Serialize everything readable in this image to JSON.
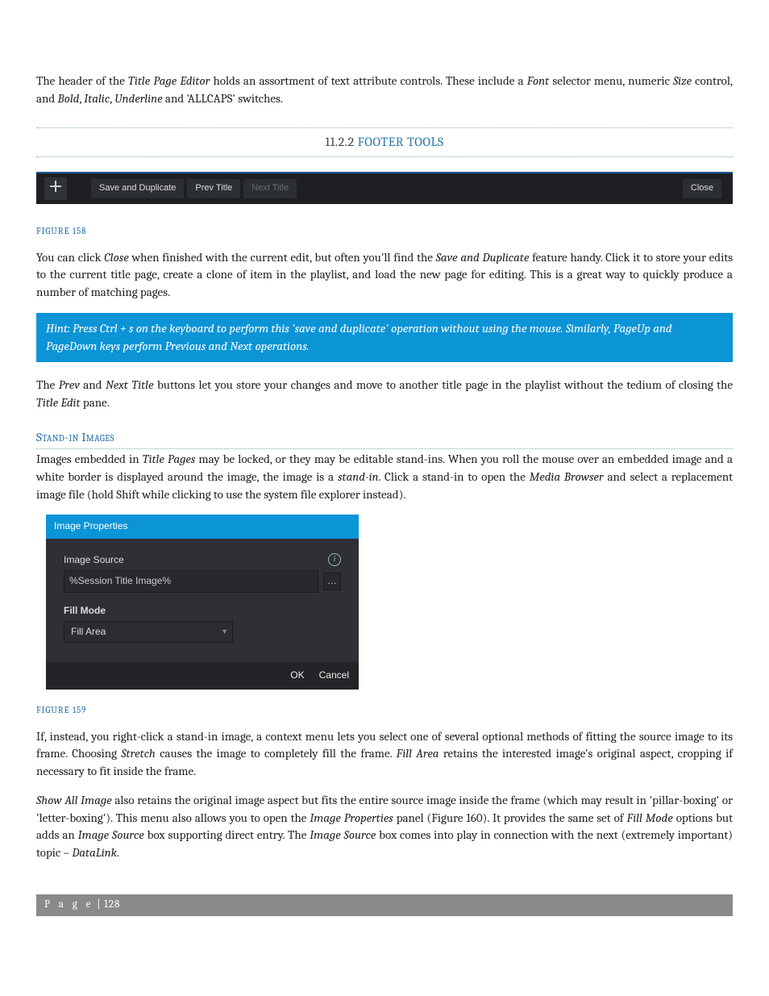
{
  "para1": {
    "a": "The header of the ",
    "b": "Title Page Editor",
    "c": " holds an assortment of text attribute controls.  These include a ",
    "d": "Font",
    "e": " selector menu, numeric ",
    "f": "Size",
    "g": " control, and ",
    "h": "Bold",
    "i": ", ",
    "j": "Italic",
    "k": ", ",
    "l": "Underline",
    "m": " and 'ALLCAPS' switches."
  },
  "section": {
    "num": "11.2.2",
    "title": "FOOTER TOOLS"
  },
  "toolbar": {
    "saveDup": "Save and Duplicate",
    "prev": "Prev Title",
    "next": "Next Title",
    "close": "Close"
  },
  "fig158": "FIGURE 158",
  "para2": {
    "a": "You can click ",
    "b": "Close",
    "c": " when finished with the current edit, but often you'll find the ",
    "d": "Save and Duplicate",
    "e": " feature handy.  Click it to store your edits to the current title page, create a clone of item in the playlist, and load the new page for editing.  This is a great way to quickly produce a number of matching pages."
  },
  "hint": "Hint: Press Ctrl + s on the keyboard to perform this 'save and duplicate' operation without using the mouse. Similarly, PageUp and PageDown keys perform Previous and Next operations.",
  "para3": {
    "a": "The ",
    "b": "Prev",
    "c": " and ",
    "d": "Next Title",
    "e": " buttons let you store your changes and move to another title page in the playlist without the tedium of closing the ",
    "f": "Title Edit",
    "g": " pane."
  },
  "subhead": "Stand-in Images",
  "para4": {
    "a": "Images embedded in ",
    "b": "Title Pages",
    "c": " may be locked, or they may be editable stand-ins.  When you roll the mouse over an embedded image and a white border is displayed around the image, the image is a ",
    "d": "stand-in",
    "e": ".  Click a stand-in to open the ",
    "f": "Media Browser",
    "g": " and select a replacement image file (hold Shift while clicking to use the system file explorer instead)."
  },
  "dialog": {
    "title": "Image Properties",
    "imgSourceLabel": "Image Source",
    "imgSourceValue": "%Session Title Image%",
    "fillModeLabel": "Fill Mode",
    "fillModeValue": "Fill Area",
    "ok": "OK",
    "cancel": "Cancel"
  },
  "fig159": "FIGURE 159",
  "para5": {
    "a": "If, instead, you right-click a stand-in image, a context menu lets you select one of several optional methods of fitting the source image to its frame.  Choosing ",
    "b": "Stretch",
    "c": " causes the image to completely fill the frame.  ",
    "d": "Fill Area",
    "e": " retains the interested image's original aspect, cropping if necessary to fit inside the frame."
  },
  "para6": {
    "a": "Show All Image",
    "b": " also retains the original image aspect but fits the entire source image inside the frame (which may result in 'pillar-boxing' or 'letter-boxing'). This menu also allows you to open the ",
    "c": "Image Properties",
    "d": " panel (Figure 160).  It provides the same set of ",
    "e": "Fill Mode",
    "f": " options but adds an ",
    "g": "Image Source",
    "h": " box supporting direct entry.  The ",
    "i": "Image Source",
    "j": " box comes into play in connection with the next (extremely important) topic – ",
    "k": "DataLink",
    "l": "."
  },
  "footer": {
    "label": "P a g e",
    "sep": " | ",
    "num": "128"
  }
}
